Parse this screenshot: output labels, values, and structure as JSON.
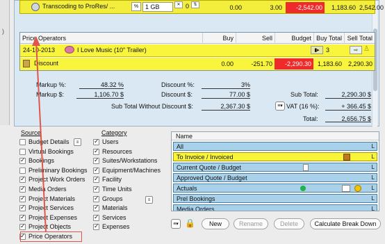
{
  "transcode_row": {
    "label": "Transcoding to ProRes/ ...",
    "percent_icon": "%",
    "size": "1 GB",
    "qty": "0",
    "buy": "0.00",
    "sell": "3.00",
    "budget": "-2,542.00",
    "buy_total": "1,183.60",
    "sell_total": "2,542.00"
  },
  "table": {
    "headers": [
      "Price Operators",
      "Buy",
      "Sell",
      "Budget",
      "Buy Total",
      "Sell Total"
    ],
    "rows": [
      {
        "date": "24-10-2013",
        "title": "I Love Music (10\" Trailer)",
        "count": "3"
      },
      {
        "name": "Discount",
        "buy": "0.00",
        "sell": "-251.70",
        "budget": "-2,290.30",
        "buy_total": "1,183.60",
        "sell_total": "2,290.30"
      }
    ]
  },
  "summary": {
    "markup_pct_label": "Markup %:",
    "markup_pct": "48.32 %",
    "markup_amt_label": "Markup $:",
    "markup_amt": "1,106.70 $",
    "discount_pct_label": "Discount %:",
    "discount_pct": "3%",
    "discount_amt_label": "Discount $:",
    "discount_amt": "77.00 $",
    "subtotal_nd_label": "Sub Total Without Discount $:",
    "subtotal_nd": "2,367.30 $",
    "subtotal_label": "Sub Total:",
    "subtotal": "2,290.30 $",
    "vat_label": "VAT (16 %):",
    "vat": "+ 366.45 $",
    "total_label": "Total:",
    "total": "2,656.75 $"
  },
  "source": {
    "title": "Source",
    "items": [
      {
        "label": "Budget Details",
        "checked": false
      },
      {
        "label": "Virtual Bookings",
        "checked": false
      },
      {
        "label": "Bookings",
        "checked": true
      },
      {
        "label": "Preliminary Bookings",
        "checked": false
      },
      {
        "label": "Project Work Orders",
        "checked": true
      },
      {
        "label": "Media Orders",
        "checked": true
      },
      {
        "label": "Project Materials",
        "checked": true
      },
      {
        "label": "Project Services",
        "checked": true
      },
      {
        "label": "Project Expenses",
        "checked": true
      },
      {
        "label": "Project Objects",
        "checked": true
      },
      {
        "label": "Price Operators",
        "checked": true
      }
    ]
  },
  "category": {
    "title": "Category",
    "items": [
      {
        "label": "Users",
        "checked": true
      },
      {
        "label": "Resources",
        "checked": true
      },
      {
        "label": "Suites/Workstations",
        "checked": true
      },
      {
        "label": "Equipment/Machines",
        "checked": true
      },
      {
        "label": "Facility",
        "checked": true
      },
      {
        "label": "Time Units",
        "checked": true
      },
      {
        "label": "Groups",
        "checked": true
      },
      {
        "label": "Materials",
        "checked": true
      },
      {
        "label": "Services",
        "checked": true
      },
      {
        "label": "Expenses",
        "checked": true
      }
    ]
  },
  "views": {
    "header": "Name",
    "items": [
      "All",
      "To Invoice / Invoiced",
      "Current Quote / Budget",
      "Approved Quote / Budget",
      "Actuals",
      "Prel Bookings",
      "Media Orders"
    ],
    "flag": "L"
  },
  "buttons": {
    "new": "New",
    "rename": "Rename",
    "delete": "Delete",
    "calc": "Calculate Break Down"
  },
  "colors": {
    "row_yellow": "#f8f53c",
    "negative_red": "#ee2a2a",
    "list_blue": "#a9d2ea",
    "panel_blue": "#d9e8f3",
    "annotation_red": "#e0564a"
  }
}
